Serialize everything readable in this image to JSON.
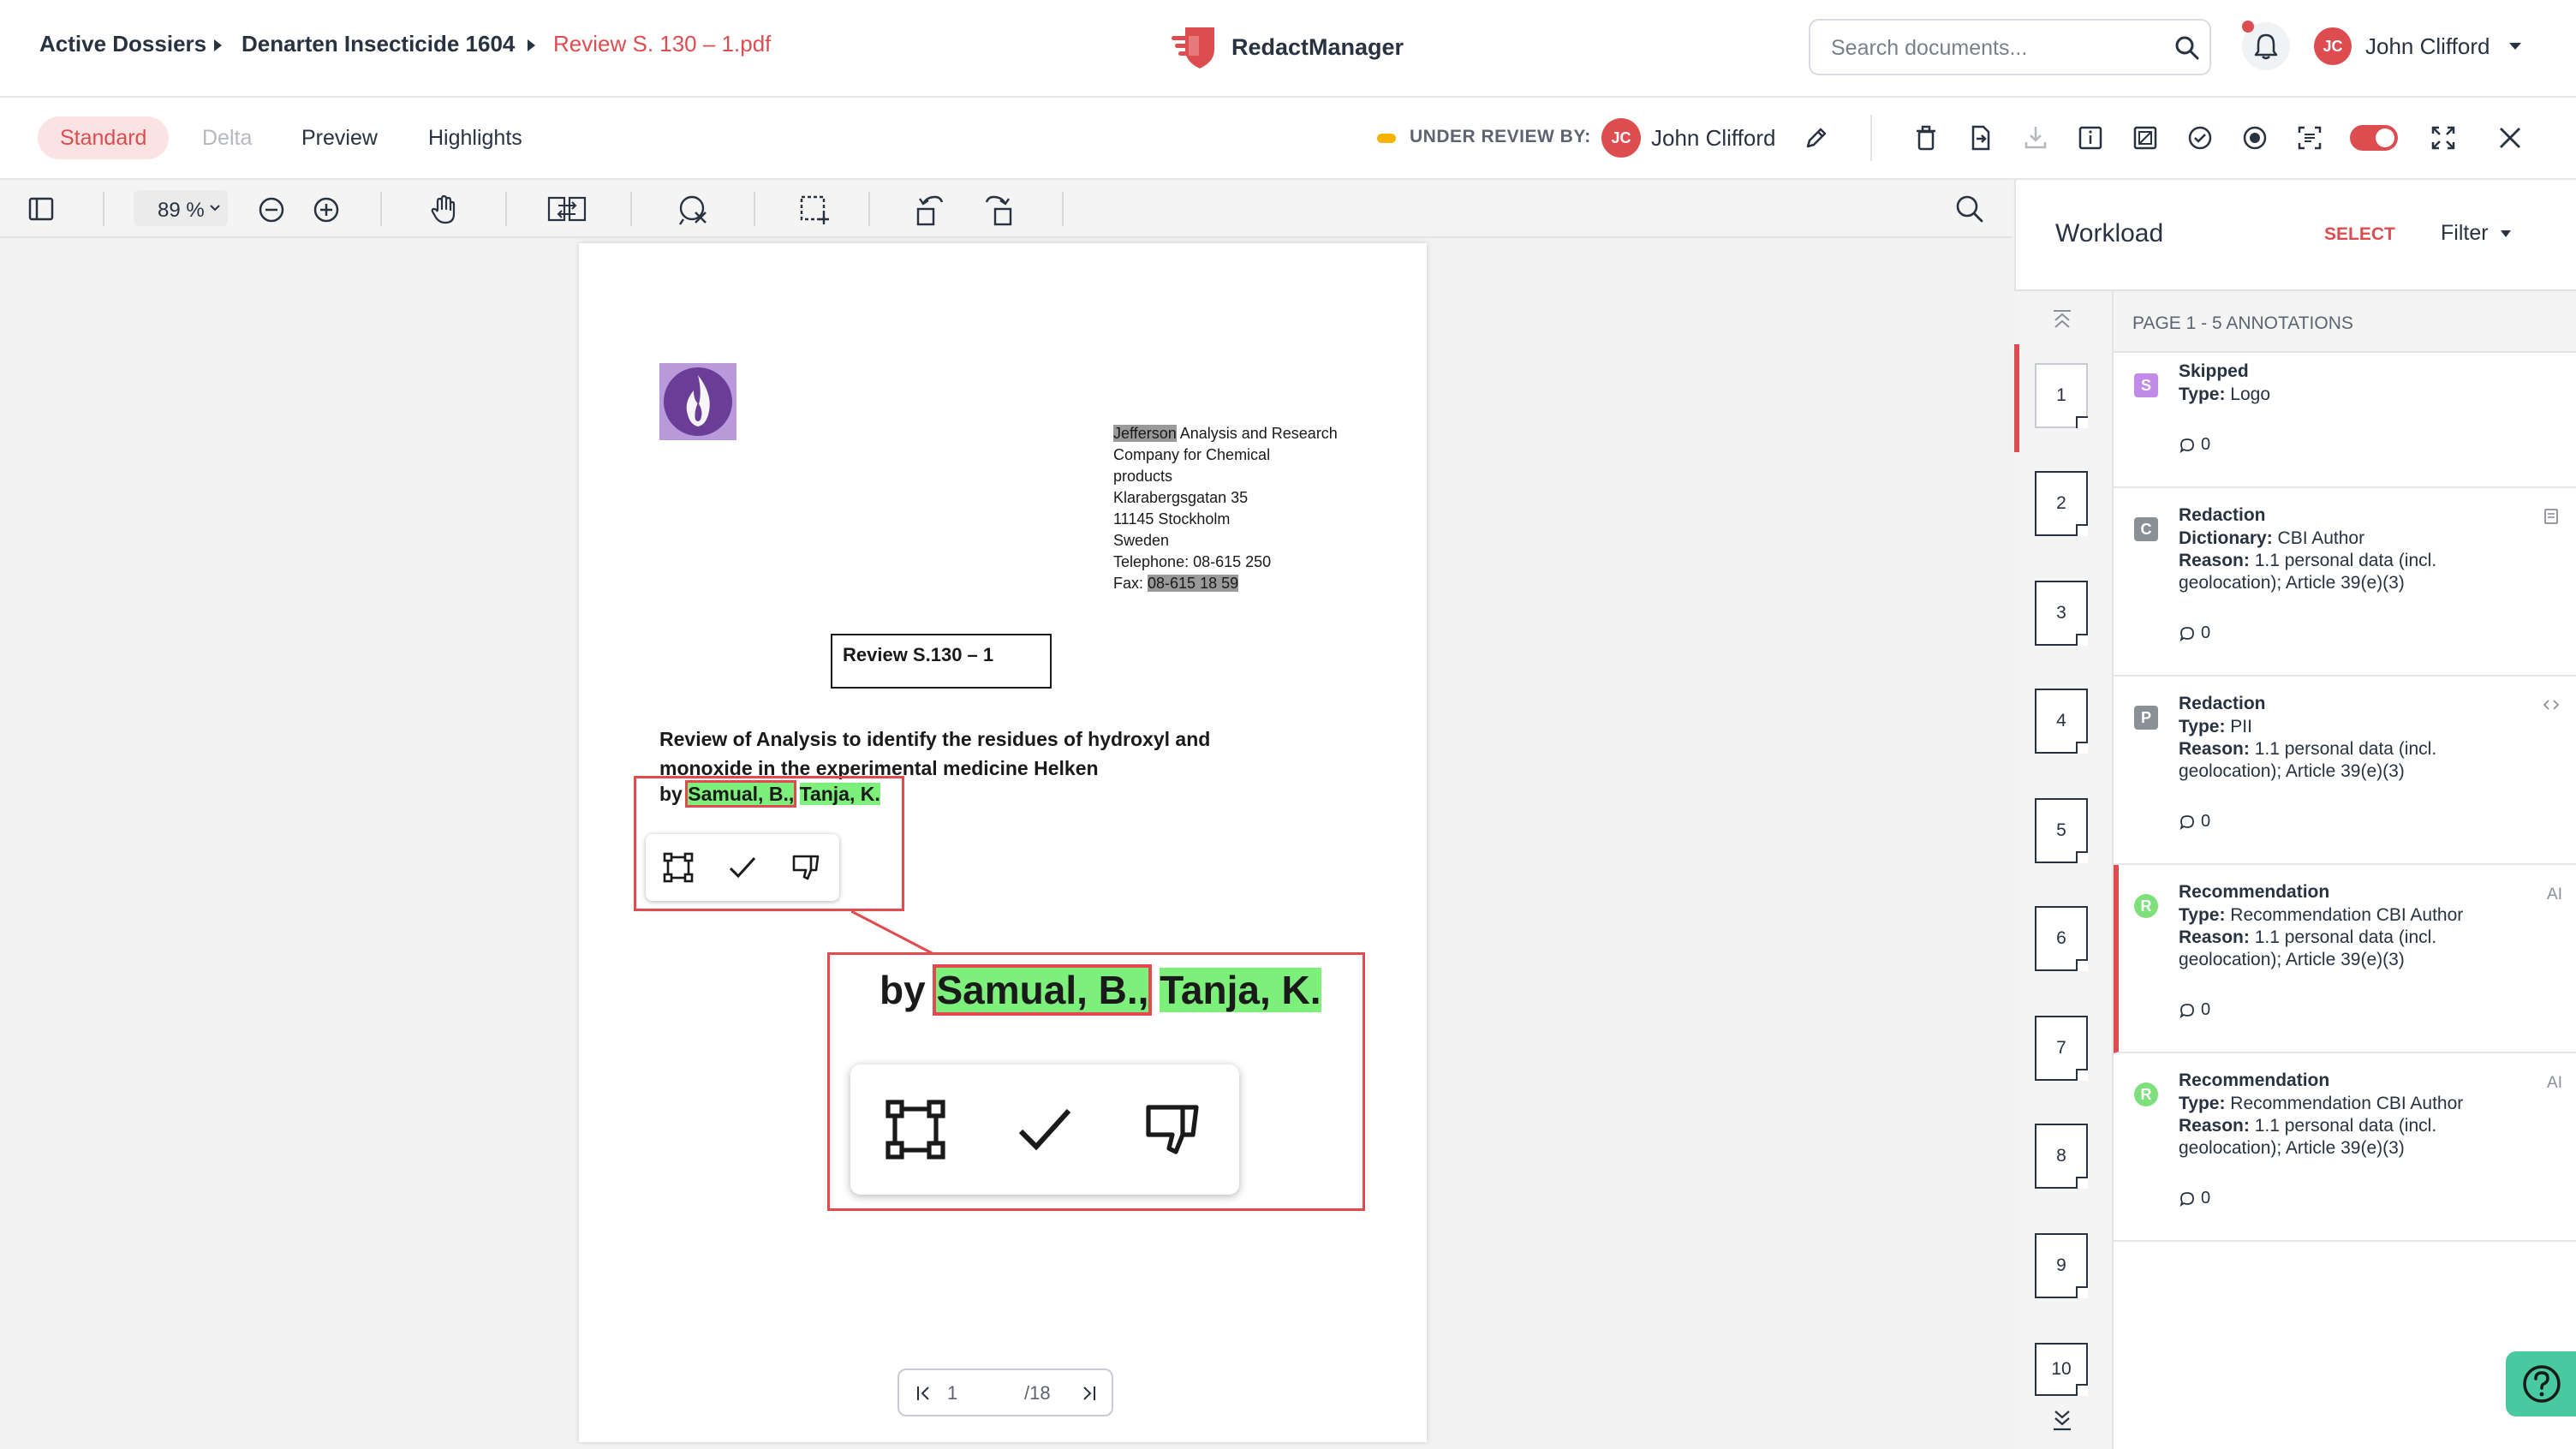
{
  "breadcrumb": {
    "items": [
      "Active Dossiers",
      "Denarten Insecticide 1604",
      "Review S. 130 – 1.pdf"
    ]
  },
  "brand": {
    "name": "RedactManager",
    "color": "#dd4d50"
  },
  "header": {
    "search_placeholder": "Search documents...",
    "user_initials": "JC",
    "user_name": "John Clifford"
  },
  "view_tabs": [
    "Standard",
    "Delta",
    "Preview",
    "Highlights"
  ],
  "review": {
    "label": "UNDER REVIEW BY:",
    "reviewer_initials": "JC",
    "reviewer_name": "John Clifford",
    "status_color": "#f5b400"
  },
  "viewer": {
    "zoom": "89 %",
    "current_page": "1",
    "total_pages": "/18"
  },
  "document": {
    "company_highlight": "Jefferson",
    "company_rest": " Analysis and Research",
    "address_lines": [
      "Company for Chemical",
      "products",
      "Klarabergsgatan 35",
      "11145 Stockholm",
      "Sweden",
      "Telephone: 08-615 250"
    ],
    "fax_label": "Fax: ",
    "fax_value": "08-615 18 59",
    "review_box": "Review S.130 – 1",
    "title_line1": "Review of Analysis to identify the residues of hydroxyl and",
    "title_line2": "monoxide in the experimental medicine Helken",
    "by": "by",
    "author1": "Samual, B.,",
    "author2": "Tanja, K."
  },
  "workload": {
    "title": "Workload",
    "select": "SELECT",
    "filter": "Filter",
    "page_header": "PAGE 1 - 5 ANNOTATIONS",
    "pages": [
      "1",
      "2",
      "3",
      "4",
      "5",
      "6",
      "7",
      "8",
      "9",
      "10"
    ],
    "annotations": [
      {
        "badge": "S",
        "badge_color": "#c38be8",
        "title": "Skipped",
        "lines": [
          {
            "k": "Type:",
            "v": " Logo"
          }
        ],
        "comments": "0",
        "tag": ""
      },
      {
        "badge": "C",
        "badge_color": "#8b8f96",
        "title": "Redaction",
        "lines": [
          {
            "k": "Dictionary:",
            "v": " CBI Author"
          },
          {
            "k": "Reason:",
            "v": " 1.1 personal data (incl. geolocation); Article 39(e)(3)"
          }
        ],
        "comments": "0",
        "tag": ""
      },
      {
        "badge": "P",
        "badge_color": "#8b8f96",
        "title": "Redaction",
        "lines": [
          {
            "k": "Type:",
            "v": " PII"
          },
          {
            "k": "Reason:",
            "v": " 1.1 personal data (incl. geolocation); Article 39(e)(3)"
          }
        ],
        "comments": "0",
        "tag": ""
      },
      {
        "badge": "R",
        "badge_color": "#7ee07a",
        "title": "Recommendation",
        "lines": [
          {
            "k": "Type:",
            "v": " Recommendation CBI Author"
          },
          {
            "k": "Reason:",
            "v": " 1.1 personal data (incl. geolocation); Article 39(e)(3)"
          }
        ],
        "comments": "0",
        "tag": "AI"
      },
      {
        "badge": "R",
        "badge_color": "#7ee07a",
        "title": "Recommendation",
        "lines": [
          {
            "k": "Type:",
            "v": " Recommendation CBI Author"
          },
          {
            "k": "Reason:",
            "v": " 1.1 personal data (incl. geolocation); Article 39(e)(3)"
          }
        ],
        "comments": "0",
        "tag": "AI"
      }
    ]
  }
}
